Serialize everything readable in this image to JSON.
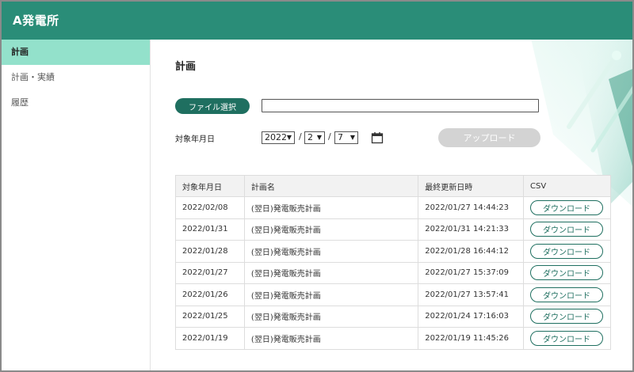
{
  "app": {
    "title": "A発電所"
  },
  "sidebar": {
    "items": [
      {
        "label": "計画",
        "active": true
      },
      {
        "label": "計画・実績",
        "active": false
      },
      {
        "label": "履歴",
        "active": false
      }
    ]
  },
  "main": {
    "title": "計画",
    "file_button_label": "ファイル選択",
    "file_input_value": "",
    "date_label": "対象年月日",
    "year_value": "2022",
    "month_value": "2",
    "day_value": "7",
    "date_separator": "/",
    "upload_button_label": "アップロード"
  },
  "table": {
    "headers": [
      "対象年月日",
      "計画名",
      "最終更新日時",
      "CSV"
    ],
    "download_label": "ダウンロード",
    "rows": [
      {
        "date": "2022/02/08",
        "name": "(翌日)発電販売計画",
        "updated": "2022/01/27 14:44:23"
      },
      {
        "date": "2022/01/31",
        "name": "(翌日)発電販売計画",
        "updated": "2022/01/31 14:21:33"
      },
      {
        "date": "2022/01/28",
        "name": "(翌日)発電販売計画",
        "updated": "2022/01/28 16:44:12"
      },
      {
        "date": "2022/01/27",
        "name": "(翌日)発電販売計画",
        "updated": "2022/01/27 15:37:09"
      },
      {
        "date": "2022/01/26",
        "name": "(翌日)発電販売計画",
        "updated": "2022/01/27 13:57:41"
      },
      {
        "date": "2022/01/25",
        "name": "(翌日)発電販売計画",
        "updated": "2022/01/24 17:16:03"
      },
      {
        "date": "2022/01/19",
        "name": "(翌日)発電販売計画",
        "updated": "2022/01/19 11:45:26"
      }
    ]
  },
  "colors": {
    "header": "#2a8d78",
    "sidebar_active": "#93e1cb",
    "primary_button": "#1f6f60",
    "disabled_button": "#d3d3d3"
  },
  "icons": {
    "calendar": "calendar-icon",
    "select_caret": "chevron-down-icon"
  }
}
